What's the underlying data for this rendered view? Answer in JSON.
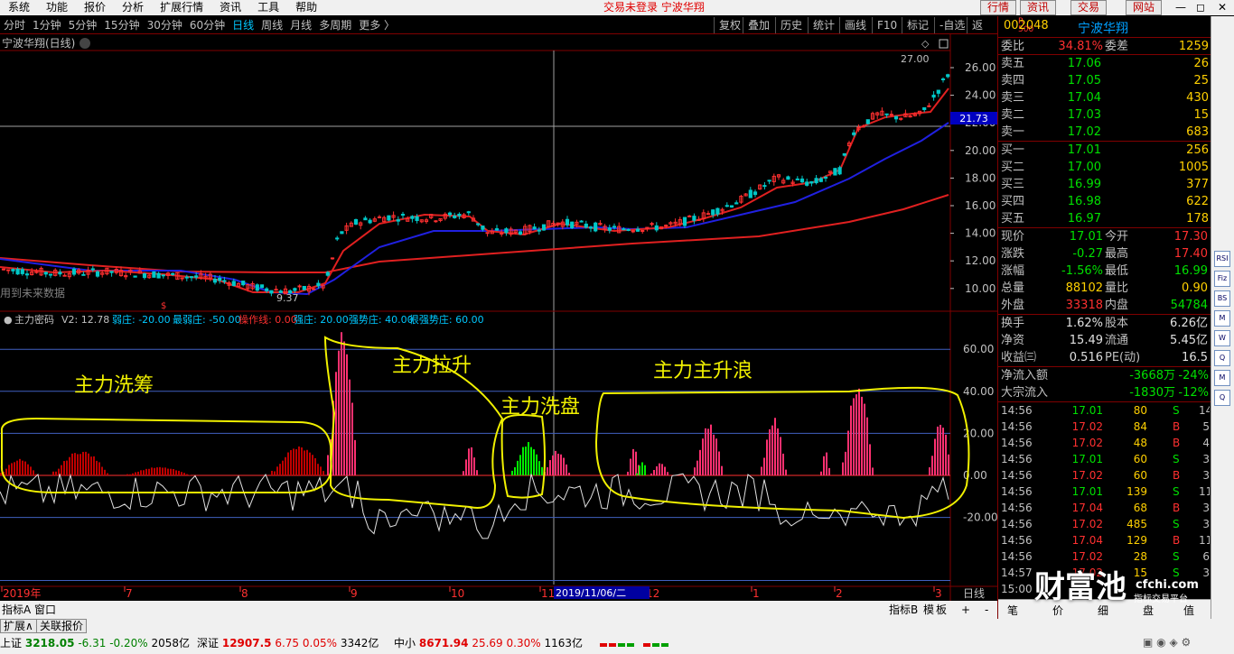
{
  "menu": [
    "系统",
    "功能",
    "报价",
    "分析",
    "扩展行情",
    "资讯",
    "工具",
    "帮助"
  ],
  "trade_status": "交易未登录  宁波华翔",
  "top_buttons": [
    "行情",
    "资讯",
    "交易",
    "网站"
  ],
  "window_controls": [
    "—",
    "◻",
    "✕"
  ],
  "periods": [
    "分时",
    "1分钟",
    "5分钟",
    "15分钟",
    "30分钟",
    "60分钟",
    "日线",
    "周线",
    "月线",
    "多周期",
    "更多 〉"
  ],
  "active_period": "日线",
  "tools": [
    "复权",
    "叠加",
    "历史",
    "统计",
    "画线",
    "F10",
    "标记",
    "-自选",
    "返回"
  ],
  "chart": {
    "title": "宁波华翔(日线)",
    "future_note": "用到未来数据",
    "high_label": "27.00",
    "low_label": "9.37",
    "price_ticks": [
      "26.00",
      "24.00",
      "22.00",
      "20.00",
      "18.00",
      "16.00",
      "14.00",
      "12.00",
      "10.00"
    ],
    "cross_price": "21.73",
    "indicator_header": {
      "name": "主力密码",
      "v2": "V2: 12.78",
      "items": [
        {
          "label": "弱庄: -20.00",
          "color": "#00c8ff"
        },
        {
          "label": "最弱庄: -50.00",
          "color": "#00c8ff"
        },
        {
          "label": "操作线: 0.00",
          "color": "#ff3030"
        },
        {
          "label": "强庄: 20.00",
          "color": "#00c8ff"
        },
        {
          "label": "强势庄: 40.00",
          "color": "#00c8ff"
        },
        {
          "label": "很强势庄: 60.00",
          "color": "#00c8ff"
        }
      ]
    },
    "ind_ticks": [
      "60.00",
      "40.00",
      "20.00",
      "0.00",
      "-20.00"
    ],
    "annotations": [
      "主力洗筹",
      "主力拉升",
      "主力洗盘",
      "主力主升浪"
    ],
    "date_axis": [
      "2019年",
      "7",
      "8",
      "9",
      "10",
      "11",
      "12",
      "1",
      "2",
      "3"
    ],
    "cross_date": "2019/11/06/二",
    "xaxis_right": "日线",
    "indicator_tabs": [
      "指标A",
      "窗口"
    ],
    "indicator_tabs_right": [
      "指标B",
      "模",
      "板",
      "+",
      "-"
    ]
  },
  "quote": {
    "code": "002048",
    "name": "宁波华翔",
    "rl": "R",
    "rl2": "500",
    "wb": {
      "label": "委比",
      "value": "34.81%",
      "label2": "委差",
      "value2": "1259"
    },
    "sells": [
      {
        "label": "卖五",
        "price": "17.06",
        "vol": "26"
      },
      {
        "label": "卖四",
        "price": "17.05",
        "vol": "25"
      },
      {
        "label": "卖三",
        "price": "17.04",
        "vol": "430"
      },
      {
        "label": "卖二",
        "price": "17.03",
        "vol": "15"
      },
      {
        "label": "卖一",
        "price": "17.02",
        "vol": "683"
      }
    ],
    "buys": [
      {
        "label": "买一",
        "price": "17.01",
        "vol": "256"
      },
      {
        "label": "买二",
        "price": "17.00",
        "vol": "1005"
      },
      {
        "label": "买三",
        "price": "16.99",
        "vol": "377"
      },
      {
        "label": "买四",
        "price": "16.98",
        "vol": "622"
      },
      {
        "label": "买五",
        "price": "16.97",
        "vol": "178"
      }
    ],
    "stats": [
      {
        "l1": "现价",
        "v1": "17.01",
        "c1": "grn",
        "l2": "今开",
        "v2": "17.30",
        "c2": "red"
      },
      {
        "l1": "涨跌",
        "v1": "-0.27",
        "c1": "grn",
        "l2": "最高",
        "v2": "17.40",
        "c2": "red"
      },
      {
        "l1": "涨幅",
        "v1": "-1.56%",
        "c1": "grn",
        "l2": "最低",
        "v2": "16.99",
        "c2": "grn"
      },
      {
        "l1": "总量",
        "v1": "88102",
        "c1": "yel",
        "l2": "量比",
        "v2": "0.90",
        "c2": "yel"
      },
      {
        "l1": "外盘",
        "v1": "33318",
        "c1": "red",
        "l2": "内盘",
        "v2": "54784",
        "c2": "grn"
      }
    ],
    "stats2": [
      {
        "l1": "换手",
        "v1": "1.62%",
        "c1": "wht",
        "l2": "股本",
        "v2": "6.26亿",
        "c2": "wht"
      },
      {
        "l1": "净资",
        "v1": "15.49",
        "c1": "wht",
        "l2": "流通",
        "v2": "5.45亿",
        "c2": "wht"
      },
      {
        "l1": "收益㈢",
        "v1": "0.516",
        "c1": "wht",
        "l2": "PE(动)",
        "v2": "16.5",
        "c2": "wht"
      }
    ],
    "flow": [
      {
        "label": "净流入额",
        "value": "-3668万",
        "pct": "-24%"
      },
      {
        "label": "大宗流入",
        "value": "-1830万",
        "pct": "-12%"
      }
    ],
    "ticks": [
      {
        "t": "14:56",
        "p": "17.01",
        "v": "80",
        "bs": "S",
        "n": "14"
      },
      {
        "t": "14:56",
        "p": "17.02",
        "v": "84",
        "bs": "B",
        "n": "5"
      },
      {
        "t": "14:56",
        "p": "17.02",
        "v": "48",
        "bs": "B",
        "n": "4"
      },
      {
        "t": "14:56",
        "p": "17.01",
        "v": "60",
        "bs": "S",
        "n": "3"
      },
      {
        "t": "14:56",
        "p": "17.02",
        "v": "60",
        "bs": "B",
        "n": "3"
      },
      {
        "t": "14:56",
        "p": "17.01",
        "v": "139",
        "bs": "S",
        "n": "11"
      },
      {
        "t": "14:56",
        "p": "17.04",
        "v": "68",
        "bs": "B",
        "n": "3"
      },
      {
        "t": "14:56",
        "p": "17.02",
        "v": "485",
        "bs": "S",
        "n": "3"
      },
      {
        "t": "14:56",
        "p": "17.04",
        "v": "129",
        "bs": "B",
        "n": "11"
      },
      {
        "t": "14:56",
        "p": "17.02",
        "v": "28",
        "bs": "S",
        "n": "6"
      },
      {
        "t": "14:57",
        "p": "17.02",
        "v": "15",
        "bs": "S",
        "n": "3"
      },
      {
        "t": "15:00",
        "p": "",
        "v": "",
        "bs": "",
        "n": ""
      }
    ],
    "bottom_tabs": [
      "笔",
      "价",
      "细",
      "盘",
      "值"
    ]
  },
  "watermark": {
    "main": "财富池",
    "site": "cfchi.com",
    "sub": "指标交易平台"
  },
  "sidetabs": [
    "RSI",
    "Fiz",
    "BS",
    "M",
    "W",
    "Q",
    "M",
    "Q"
  ],
  "bottom": {
    "tabs": [
      "扩展∧",
      "关联报价"
    ],
    "indices": [
      {
        "name": "上证",
        "val": "3218.05",
        "chg": "-6.31",
        "pct": "-0.20%",
        "amt": "2058亿"
      },
      {
        "name": "深证",
        "val": "12907.5",
        "chg": "6.75",
        "pct": "0.05%",
        "amt": "3342亿"
      },
      {
        "name": "中小",
        "val": "8671.94",
        "chg": "25.69",
        "pct": "0.30%",
        "amt": "1163亿"
      }
    ]
  }
}
